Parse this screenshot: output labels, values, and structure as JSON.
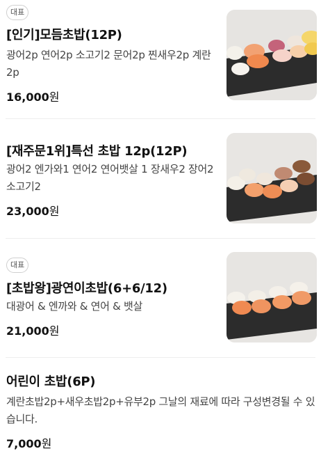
{
  "menu": {
    "items": [
      {
        "badge": "대표",
        "title": "[인기]모듬초밥(12P)",
        "desc": "광어2p 연어2p 소고기2 문어2p 찐새우2p 계란2p",
        "price_num": "16,000",
        "price_unit": "원",
        "image_icon": "sushi-assorted-image"
      },
      {
        "badge": "",
        "title": "[재주문1위]특선 초밥 12p(12P)",
        "desc": "광어2 엔가와1 연어2 연어뱃살 1 장새우2 장어2 소고기2",
        "price_num": "23,000",
        "price_unit": "원",
        "image_icon": "sushi-special-image"
      },
      {
        "badge": "대표",
        "title": "[초밥왕]광연이초밥(6+6/12)",
        "desc": "대광어 & 엔까와 & 연어 & 뱃살",
        "price_num": "21,000",
        "price_unit": "원",
        "image_icon": "sushi-salmon-flatfish-image"
      },
      {
        "badge": "",
        "title": "어린이 초밥(6P)",
        "desc": "계란초밥2p+새우초밥2p+유부2p 그날의 재료에 따라 구성변경될 수 있습니다.",
        "price_num": "7,000",
        "price_unit": "원",
        "image_icon": ""
      }
    ]
  },
  "colors": {
    "background": "#ffffff",
    "text_primary": "#111111",
    "text_secondary": "#444444",
    "divider": "#eeeeee",
    "badge_border": "#cfcfcf"
  }
}
